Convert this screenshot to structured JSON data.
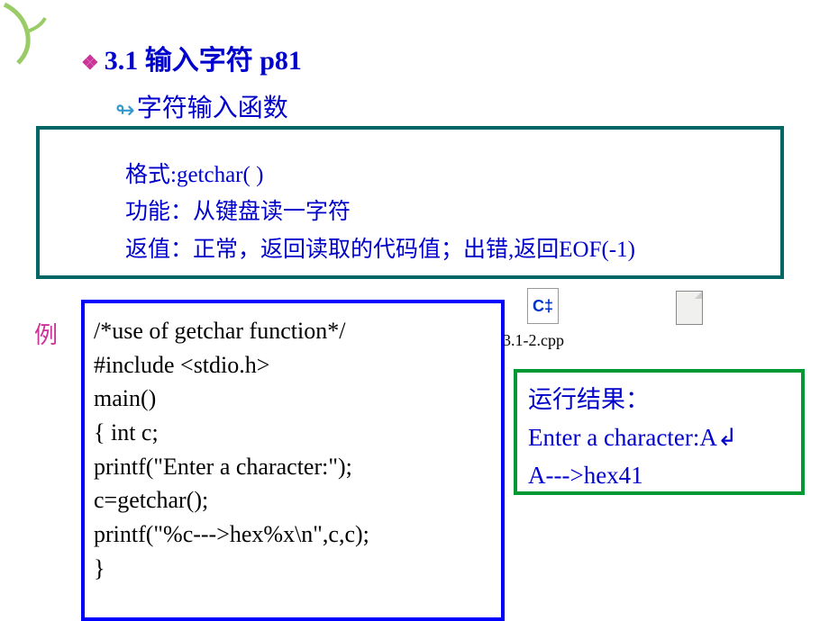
{
  "heading": {
    "title": "3.1  输入字符 p81"
  },
  "subheading": {
    "title": "字符输入函数"
  },
  "desc": {
    "line1": "格式:getchar( )",
    "line2": "功能：从键盘读一字符",
    "line3": "返值：正常，返回读取的代码值；出错,返回EOF(-1)"
  },
  "example": {
    "label": "例"
  },
  "code": {
    "line1": "/*use of getchar function*/",
    "line2": "#include <stdio.h>",
    "line3": "main()",
    "line4": "{  int c;",
    "line5": "   printf(\"Enter a character:\");",
    "line6": "   c=getchar();",
    "line7": "   printf(\"%c--->hex%x\\n\",c,c);",
    "line8": "}"
  },
  "file": {
    "icon_text": "C‡",
    "name": "3.1-2.cpp"
  },
  "result": {
    "title": "运行结果：",
    "line1": "Enter a character:A↲",
    "line2": "A--->hex41"
  }
}
